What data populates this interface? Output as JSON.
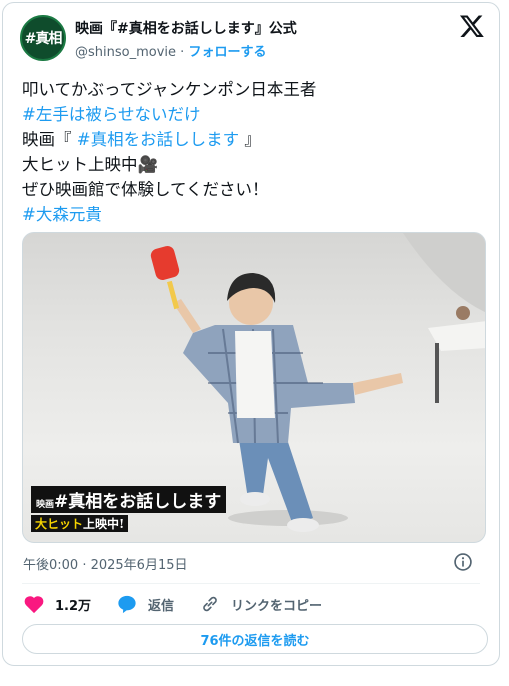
{
  "header": {
    "avatar_text": "#真相",
    "display_name": "映画『#真相をお話しします』公式",
    "handle": "@shinso_movie",
    "separator": "·",
    "follow_label": "フォローする"
  },
  "tweet": {
    "lines": [
      "叩いてかぶってジャンケンポン日本王者",
      "#左手は被らせないだけ",
      "映画『",
      "#真相をお話しします",
      "』",
      "大ヒット上映中🎥",
      "ぜひ映画館で体験してください！",
      "#大森元貴"
    ]
  },
  "media": {
    "caption_prefix": "映画",
    "caption_title": "#真相をお話しします",
    "caption_sub_1": "大ヒット",
    "caption_sub_2": "上映中!"
  },
  "meta": {
    "timestamp": "午後0:00 · 2025年6月15日"
  },
  "actions": {
    "likes": "1.2万",
    "reply_label": "返信",
    "copy_link_label": "リンクをコピー"
  },
  "read_replies_label": "76件の返信を読む",
  "colors": {
    "link": "#1d9bf0",
    "like": "#f91880",
    "text": "#0f1419",
    "muted": "#536471"
  },
  "icons": [
    "x-logo-icon",
    "info-icon",
    "heart-icon",
    "reply-bubble-icon",
    "link-icon"
  ]
}
